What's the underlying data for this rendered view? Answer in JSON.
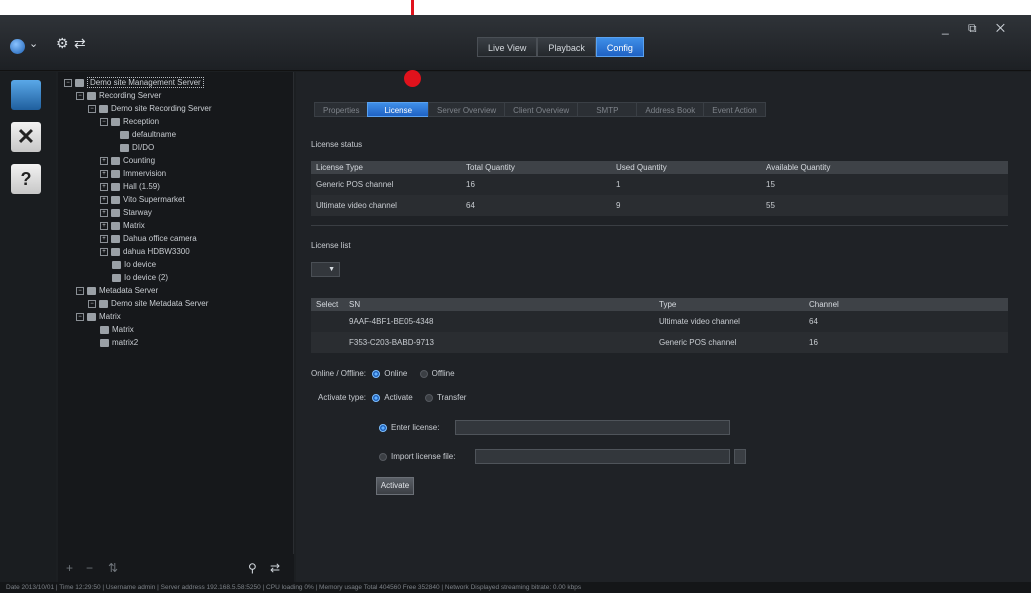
{
  "window": {
    "controls": "_ ⧉ ✕"
  },
  "main_tabs": [
    {
      "label": "Live View",
      "active": false
    },
    {
      "label": "Playback",
      "active": false
    },
    {
      "label": "Config",
      "active": true
    }
  ],
  "rail_icons": [
    "server-icon",
    "tools-icon",
    "help-icon"
  ],
  "tree": [
    {
      "label": "Demo site Management Server",
      "selected": true
    },
    {
      "label": "Recording Server"
    },
    {
      "label": "Demo site Recording Server"
    },
    {
      "label": "Reception"
    },
    {
      "label": "defaultname"
    },
    {
      "label": "DI/DO"
    },
    {
      "label": "Counting"
    },
    {
      "label": "Immervision"
    },
    {
      "label": "Hall (1.59)"
    },
    {
      "label": "Vito Supermarket"
    },
    {
      "label": "Starway"
    },
    {
      "label": "Matrix"
    },
    {
      "label": "Dahua office camera"
    },
    {
      "label": "dahua HDBW3300"
    },
    {
      "label": "Io device"
    },
    {
      "label": "Io device (2)"
    },
    {
      "label": "Metadata Server"
    },
    {
      "label": "Demo site Metadata Server"
    },
    {
      "label": "Matrix"
    },
    {
      "label": "Matrix"
    },
    {
      "label": "matrix2"
    }
  ],
  "sub_tabs": [
    {
      "label": "Properties",
      "active": false
    },
    {
      "label": "License",
      "active": true
    },
    {
      "label": "Server Overview",
      "active": false
    },
    {
      "label": "Client Overview",
      "active": false
    },
    {
      "label": "SMTP",
      "active": false
    },
    {
      "label": "Address Book",
      "active": false
    },
    {
      "label": "Event Action",
      "active": false
    }
  ],
  "license_status": {
    "title": "License status",
    "headers": [
      "License Type",
      "Total Quantity",
      "Used Quantity",
      "Available Quantity"
    ],
    "rows": [
      [
        "Generic POS channel",
        "16",
        "1",
        "15"
      ],
      [
        "Ultimate video channel",
        "64",
        "9",
        "55"
      ]
    ]
  },
  "license_list": {
    "title": "License list",
    "headers": [
      "Select",
      "SN",
      "Type",
      "Channel"
    ],
    "rows": [
      [
        "",
        "9AAF-4BF1-BE05-4348",
        "Ultimate video channel",
        "64"
      ],
      [
        "",
        "F353-C203-BABD-9713",
        "Generic POS channel",
        "16"
      ]
    ]
  },
  "online_offline": {
    "label": "Online / Offline:",
    "options": [
      "Online",
      "Offline"
    ],
    "selected": "Online"
  },
  "activate_type": {
    "label": "Activate type:",
    "options": [
      "Activate",
      "Transfer"
    ],
    "selected": "Activate"
  },
  "enter_license": {
    "label": "Enter license:",
    "value": ""
  },
  "import_license": {
    "label": "Import license file:",
    "value": ""
  },
  "activate_button": "Activate",
  "status_bar": "Date 2013/10/01 | Time 12:29:50 | Username admin | Server address 192.168.5.58:5250 | CPU loading 0% | Memory usage Total 404560 Free 352840 | Network Displayed streaming bitrate: 0.00 kbps"
}
